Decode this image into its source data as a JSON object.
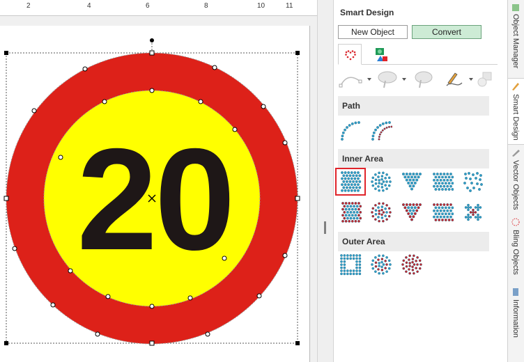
{
  "ruler": {
    "numbers": [
      "2",
      "4",
      "6",
      "8",
      "10",
      "11"
    ]
  },
  "sign": {
    "number": "20",
    "colors": {
      "ring": "#dd2119",
      "inner": "#ffff00",
      "text": "#1e1717"
    }
  },
  "panel": {
    "title": "Smart Design",
    "new_object_label": "New Object",
    "convert_label": "Convert",
    "sections": {
      "path": "Path",
      "inner": "Inner Area",
      "outer": "Outer Area"
    }
  },
  "side_tabs": {
    "object_manager": "Object Manager",
    "smart_design": "Smart Design",
    "vector_objects": "Vector Objects",
    "bling_objects": "Bling Objects",
    "information": "Information"
  },
  "icons": {
    "tab1": "heart-dots-icon",
    "tab2": "shapes-icon",
    "tools": [
      "bezier-path-icon",
      "blob-brush-icon",
      "eraser-blob-icon",
      "pen-curve-icon",
      "shape-tool-icon"
    ]
  }
}
